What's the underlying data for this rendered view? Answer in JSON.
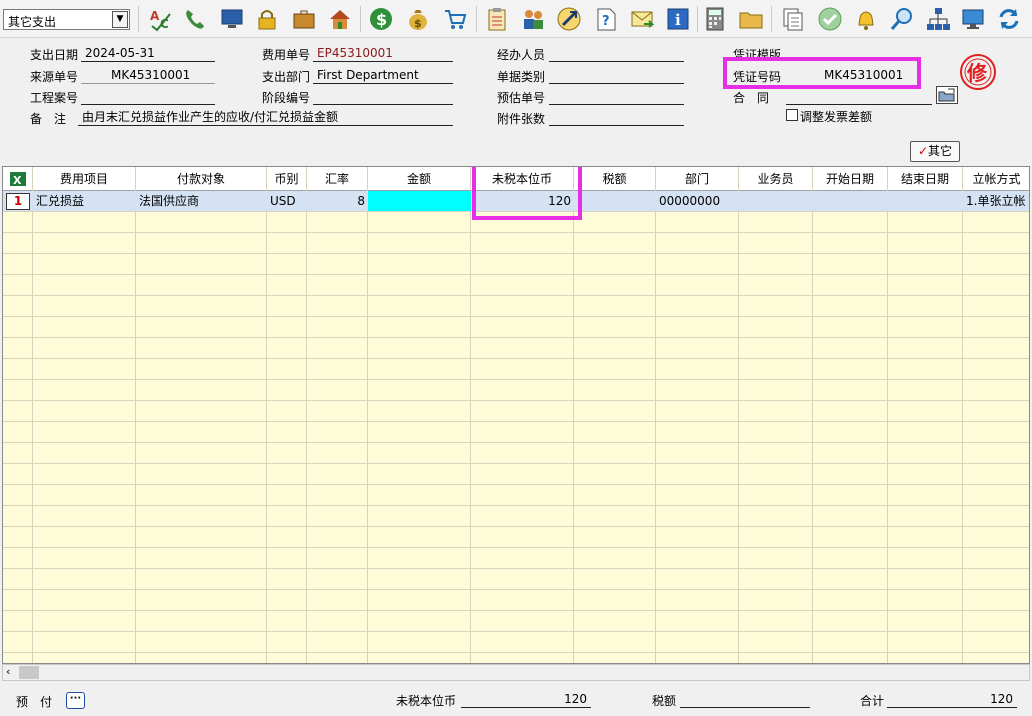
{
  "toolbar": {
    "module_select": "其它支出",
    "buttons": [
      "spell-check-icon",
      "phone-icon",
      "monitor-icon",
      "lock-icon",
      "briefcase-icon",
      "home-icon",
      "dollar-icon",
      "money-bag-icon",
      "cart-icon",
      "clipboard-icon",
      "users-icon",
      "link-icon",
      "help-doc-icon",
      "mail-icon",
      "info-icon",
      "calculator-icon",
      "folder-icon",
      "copy-doc-icon",
      "check-circle-icon",
      "bell-icon",
      "search-icon",
      "org-chart-icon",
      "screen-icon",
      "refresh-icon"
    ]
  },
  "header": {
    "expense_date_label": "支出日期",
    "expense_date": "2024-05-31",
    "source_no_label": "来源单号",
    "source_no": "MK45310001",
    "project_no_label": "工程案号",
    "project_no": "",
    "remark_label": "备　注",
    "remark": "由月末汇兑损益作业产生的应收/付汇兑损益金额",
    "fee_no_label": "费用单号",
    "fee_no": "EP45310001",
    "dept_label": "支出部门",
    "dept": "First Department",
    "stage_no_label": "阶段编号",
    "stage_no": "",
    "handler_label": "经办人员",
    "handler": "",
    "doc_type_label": "单据类别",
    "doc_type": "",
    "estimate_no_label": "预估单号",
    "estimate_no": "",
    "attach_label": "附件张数",
    "attach": "",
    "voucher_template_label": "凭证模版",
    "voucher_template": "",
    "voucher_no_label": "凭证号码",
    "voucher_no": "MK45310001",
    "contract_label": "合　同",
    "contract": "",
    "adjust_label": "调整发票差额",
    "stamp_text": "修",
    "other_button": "其它"
  },
  "grid": {
    "columns": [
      "费用项目",
      "付款对象",
      "币别",
      "汇率",
      "金额",
      "未税本位币",
      "税额",
      "部门",
      "业务员",
      "开始日期",
      "结束日期",
      "立帐方式"
    ],
    "rows": [
      {
        "num": "1",
        "cells": [
          "汇兑损益",
          "法国供应商",
          "USD",
          "8",
          "",
          "120",
          "",
          "00000000",
          "",
          "",
          "",
          "1.单张立帐"
        ]
      }
    ]
  },
  "footer": {
    "prepaid_label": "预　付",
    "untaxed_label": "未税本位币",
    "untaxed": "120",
    "tax_label": "税额",
    "tax": "",
    "total_label": "合计",
    "total": "120"
  },
  "colors": {
    "highlight": "#e52ee5",
    "grid_bg": "#fdfbd8",
    "selected_row": "#d4e2f4",
    "amount_cell": "#00ffff"
  }
}
